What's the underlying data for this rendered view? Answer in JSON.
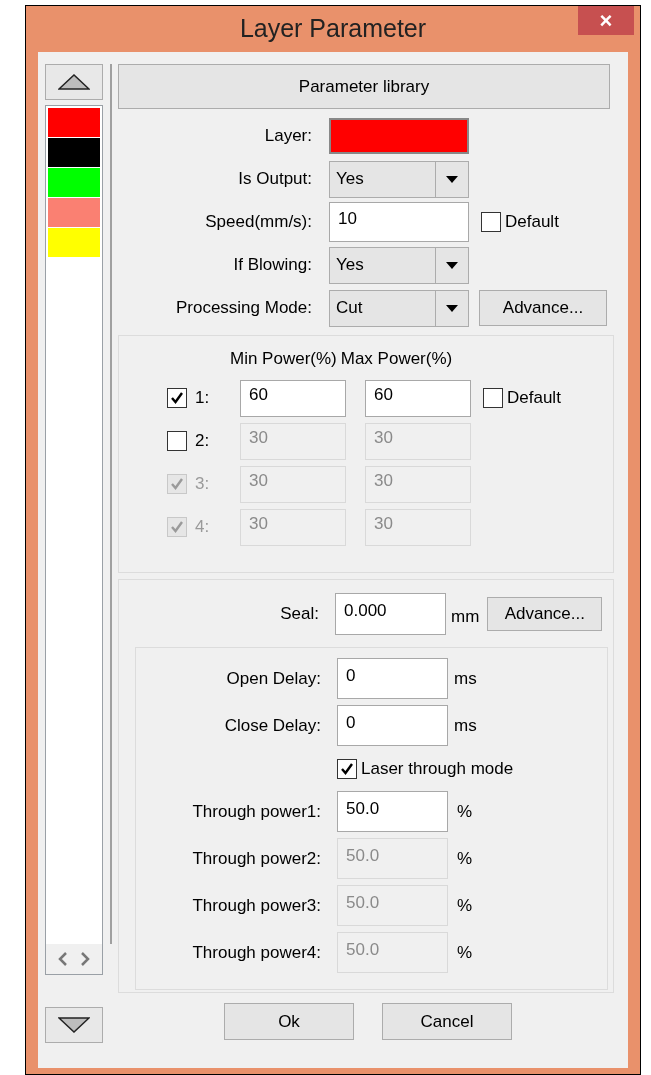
{
  "window": {
    "title": "Layer Parameter",
    "close": "×"
  },
  "layer_list": {
    "layers": [
      {
        "color": "#ff0000"
      },
      {
        "color": "#000000"
      },
      {
        "color": "#00ff00"
      },
      {
        "color": "#fa8072"
      },
      {
        "color": "#ffff00"
      }
    ]
  },
  "parameter_library": "Parameter library",
  "fields": [
    {
      "kind": "color",
      "label": "Layer:",
      "color": "#ff0000"
    },
    {
      "kind": "dropdown",
      "label": "Is Output:",
      "value": "Yes"
    },
    {
      "kind": "text",
      "label": "Speed(mm/s):",
      "value": "10",
      "checkbox": {
        "label": "Default",
        "checked": false
      }
    },
    {
      "kind": "dropdown",
      "label": "If Blowing:",
      "value": "Yes"
    },
    {
      "kind": "dropdown",
      "label": "Processing Mode:",
      "value": "Cut",
      "button": "Advance..."
    }
  ],
  "power": {
    "headers": [
      "Min Power(%)",
      "Max Power(%)"
    ],
    "rows": [
      {
        "label": "1:",
        "checked": true,
        "disabled": false,
        "inputs_disabled": false,
        "min": "60",
        "max": "60"
      },
      {
        "label": "2:",
        "checked": false,
        "disabled": false,
        "inputs_disabled": true,
        "min": "30",
        "max": "30"
      },
      {
        "label": "3:",
        "checked": true,
        "disabled": true,
        "inputs_disabled": true,
        "min": "30",
        "max": "30"
      },
      {
        "label": "4:",
        "checked": true,
        "disabled": true,
        "inputs_disabled": true,
        "min": "30",
        "max": "30"
      }
    ],
    "default": {
      "label": "Default",
      "checked": false
    }
  },
  "seal": {
    "label": "Seal:",
    "value": "0.000",
    "unit": "mm",
    "button": "Advance..."
  },
  "delays": [
    {
      "label": "Open Delay:",
      "value": "0",
      "unit": "ms"
    },
    {
      "label": "Close Delay:",
      "value": "0",
      "unit": "ms"
    }
  ],
  "laser_through": {
    "label": "Laser through mode",
    "checked": true
  },
  "through_powers": [
    {
      "label": "Through power1:",
      "value": "50.0",
      "unit": "%",
      "disabled": false
    },
    {
      "label": "Through power2:",
      "value": "50.0",
      "unit": "%",
      "disabled": true
    },
    {
      "label": "Through power3:",
      "value": "50.0",
      "unit": "%",
      "disabled": true
    },
    {
      "label": "Through power4:",
      "value": "50.0",
      "unit": "%",
      "disabled": true
    }
  ],
  "buttons": [
    "Ok",
    "Cancel"
  ]
}
